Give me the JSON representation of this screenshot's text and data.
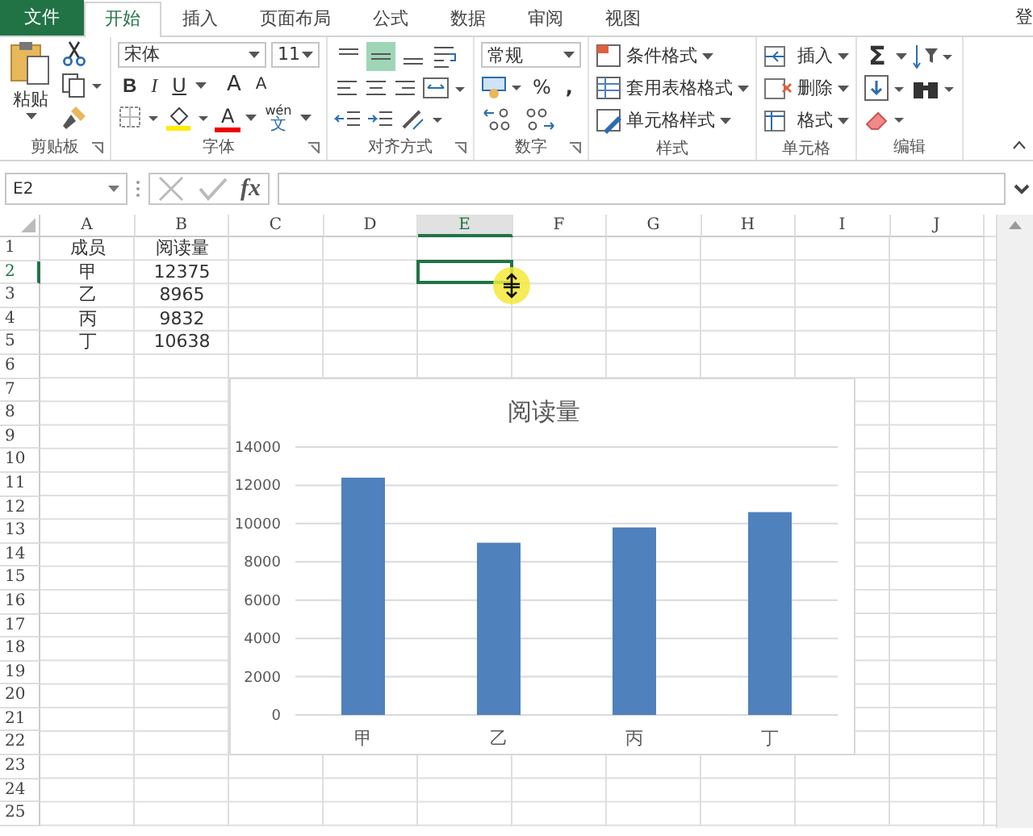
{
  "tabs": [
    {
      "label": "文件",
      "kind": "file",
      "selected": false
    },
    {
      "label": "开始",
      "kind": "tab",
      "selected": true
    },
    {
      "label": "插入",
      "kind": "tab",
      "selected": false
    },
    {
      "label": "页面布局",
      "kind": "tab",
      "selected": false
    },
    {
      "label": "公式",
      "kind": "tab",
      "selected": false
    },
    {
      "label": "数据",
      "kind": "tab",
      "selected": false
    },
    {
      "label": "审阅",
      "kind": "tab",
      "selected": false
    },
    {
      "label": "视图",
      "kind": "tab",
      "selected": false
    }
  ],
  "account": "登",
  "ribbon": {
    "clipboard": {
      "label": "剪贴板",
      "paste": "粘贴"
    },
    "font": {
      "label": "字体",
      "name": "宋体",
      "size": "11",
      "grow": "A",
      "shrink": "A",
      "color_button": "A",
      "phonetic_top": "wén",
      "phonetic_bottom": "文",
      "styles": [
        {
          "kind": "bold",
          "label": "B"
        },
        {
          "kind": "italic",
          "label": "I"
        },
        {
          "kind": "underline",
          "label": "U"
        }
      ]
    },
    "alignment": {
      "label": "对齐方式",
      "vertical": [
        {
          "kind": "top",
          "selected": false
        },
        {
          "kind": "middle",
          "selected": true
        },
        {
          "kind": "bottom",
          "selected": false
        }
      ]
    },
    "number": {
      "label": "数字",
      "format": "常规",
      "percent": "%",
      "comma": ","
    },
    "styles": {
      "label": "样式",
      "items": [
        {
          "kind": "conditional",
          "label": "条件格式"
        },
        {
          "kind": "table",
          "label": "套用表格格式"
        },
        {
          "kind": "cell",
          "label": "单元格样式"
        }
      ]
    },
    "cells": {
      "label": "单元格",
      "items": [
        {
          "kind": "insert",
          "label": "插入"
        },
        {
          "kind": "delete",
          "label": "删除"
        },
        {
          "kind": "format",
          "label": "格式"
        }
      ]
    },
    "editing": {
      "label": "编辑",
      "sum": "Σ"
    }
  },
  "formula_bar": {
    "name_box": "E2",
    "fx": "fx"
  },
  "sheet": {
    "columns": [
      {
        "label": "A",
        "selected": false
      },
      {
        "label": "B",
        "selected": false
      },
      {
        "label": "C",
        "selected": false
      },
      {
        "label": "D",
        "selected": false
      },
      {
        "label": "E",
        "selected": true
      },
      {
        "label": "F",
        "selected": false
      },
      {
        "label": "G",
        "selected": false
      },
      {
        "label": "H",
        "selected": false
      },
      {
        "label": "I",
        "selected": false
      },
      {
        "label": "J",
        "selected": false
      }
    ],
    "rows": [
      {
        "number": "1",
        "selected": false,
        "cells": [
          "成员",
          "阅读量"
        ]
      },
      {
        "number": "2",
        "selected": true,
        "cells": [
          "甲",
          "12375"
        ]
      },
      {
        "number": "3",
        "selected": false,
        "cells": [
          "乙",
          "8965"
        ]
      },
      {
        "number": "4",
        "selected": false,
        "cells": [
          "丙",
          "9832"
        ]
      },
      {
        "number": "5",
        "selected": false,
        "cells": [
          "丁",
          "10638"
        ]
      },
      {
        "number": "6",
        "selected": false,
        "cells": []
      },
      {
        "number": "7",
        "selected": false,
        "cells": []
      },
      {
        "number": "8",
        "selected": false,
        "cells": []
      },
      {
        "number": "9",
        "selected": false,
        "cells": []
      },
      {
        "number": "10",
        "selected": false,
        "cells": []
      },
      {
        "number": "11",
        "selected": false,
        "cells": []
      },
      {
        "number": "12",
        "selected": false,
        "cells": []
      },
      {
        "number": "13",
        "selected": false,
        "cells": []
      },
      {
        "number": "14",
        "selected": false,
        "cells": []
      },
      {
        "number": "15",
        "selected": false,
        "cells": []
      },
      {
        "number": "16",
        "selected": false,
        "cells": []
      },
      {
        "number": "17",
        "selected": false,
        "cells": []
      },
      {
        "number": "18",
        "selected": false,
        "cells": []
      },
      {
        "number": "19",
        "selected": false,
        "cells": []
      },
      {
        "number": "20",
        "selected": false,
        "cells": []
      },
      {
        "number": "21",
        "selected": false,
        "cells": []
      },
      {
        "number": "22",
        "selected": false,
        "cells": []
      },
      {
        "number": "23",
        "selected": false,
        "cells": []
      },
      {
        "number": "24",
        "selected": false,
        "cells": []
      },
      {
        "number": "25",
        "selected": false,
        "cells": []
      }
    ]
  },
  "chart": {
    "chart_data": {
      "type": "bar",
      "title": "阅读量",
      "categories": [
        "甲",
        "乙",
        "丙",
        "丁"
      ],
      "series": [
        {
          "color": "#4f81bd",
          "values": [
            12400,
            9000,
            9800,
            10600
          ]
        }
      ],
      "grid": true,
      "ylim": [
        0,
        14000
      ],
      "yticks": [
        0,
        2000,
        4000,
        6000,
        8000,
        10000,
        12000,
        14000
      ]
    }
  }
}
